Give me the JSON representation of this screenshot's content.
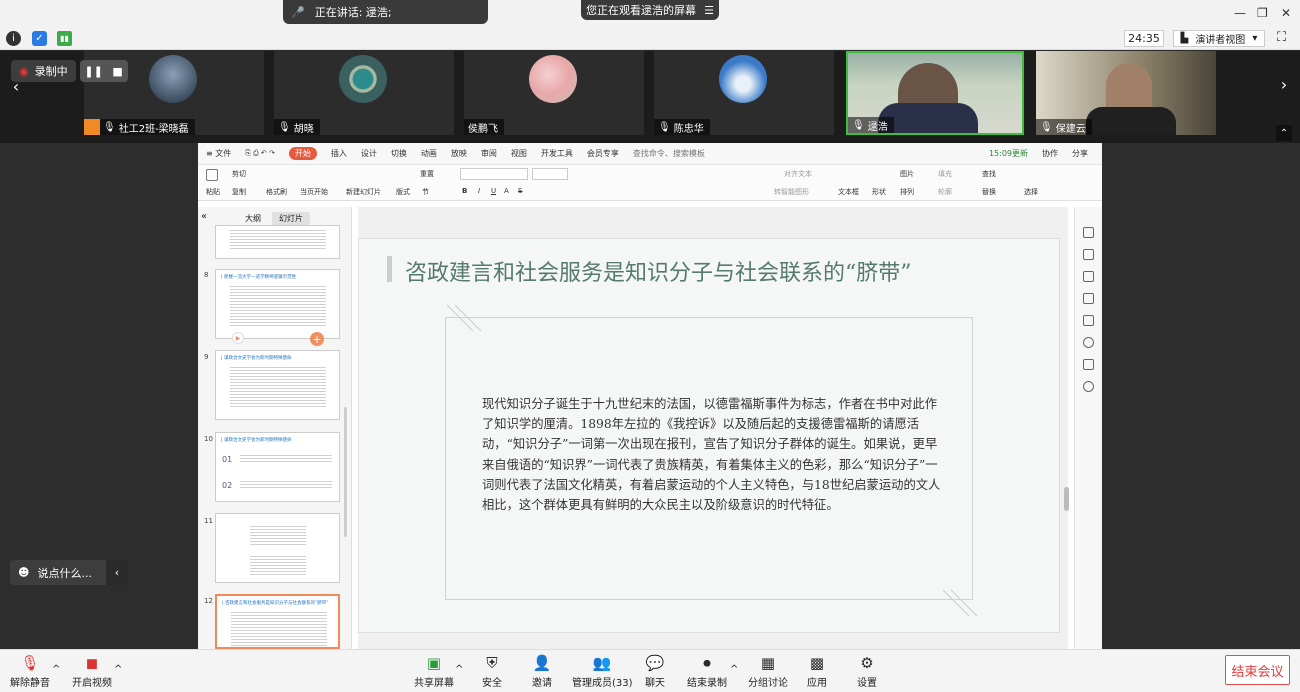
{
  "topbar": {
    "speaking_label": "正在讲话: 逯浩;",
    "viewing_label": "您正在观看逯浩的屏幕",
    "menu_glyph": "☰",
    "minimize": "—",
    "restore": "❐",
    "close": "✕"
  },
  "subbar": {
    "time": "24:35",
    "view_mode": "演讲者视图",
    "dropdown": "▾",
    "fullscreen": "⛶",
    "icons": [
      "info-icon",
      "shield-icon",
      "signal-icon"
    ]
  },
  "recording": {
    "label": "录制中",
    "pause": "❚❚",
    "stop": "■"
  },
  "participants": [
    {
      "name": "社工2班-梁晓磊",
      "mic": "off",
      "avatar_color": "#30455a"
    },
    {
      "name": "胡晓",
      "mic": "off",
      "avatar_color": "#6a8a8a"
    },
    {
      "name": "侯鹏飞",
      "mic": "none",
      "avatar_color": "#d9b8b8"
    },
    {
      "name": "陈忠华",
      "mic": "off",
      "avatar_color": "#4a86c8"
    },
    {
      "name": "逯浩",
      "mic": "on",
      "avatar_color": "#7c6a5a"
    },
    {
      "name": "保建云",
      "mic": "on",
      "avatar_color": "#5c5a52"
    }
  ],
  "wps": {
    "tabs": [
      "≡ 文件",
      "开始",
      "插入",
      "设计",
      "切换",
      "动画",
      "放映",
      "审阅",
      "视图",
      "开发工具",
      "会员专享",
      "查找命令、搜索模板"
    ],
    "active_tab": "开始",
    "right_items": [
      "15:09更新",
      "协作",
      "分享"
    ],
    "ribbon": [
      "粘贴",
      "剪切",
      "复制",
      "格式刷",
      "当页开始",
      "新建幻灯片",
      "版式",
      "节",
      "重置",
      "B",
      "I",
      "U",
      "A",
      "S",
      "对齐文本",
      "转智能图形",
      "文本框",
      "形状",
      "排列",
      "图片",
      "填充",
      "轮廓",
      "查找",
      "替换",
      "选择"
    ],
    "panel_tabs": [
      "大纲",
      "幻灯片"
    ],
    "thumbnails": [
      {
        "num": "",
        "title": ""
      },
      {
        "num": "8",
        "title": "| 爬楼一流大学—适学精神逻辑示范性"
      },
      {
        "num": "9",
        "title": "| 谋政治文史学会为新时期特殊使命"
      },
      {
        "num": "10",
        "title": "| 谋政治文史学会为新时期特殊使命"
      },
      {
        "num": "11",
        "title": ""
      },
      {
        "num": "12",
        "title": "| 咨政建言和社会服务是知识分子与社会联系的“脐带”"
      }
    ],
    "thumb10_nums": [
      "01",
      "02"
    ],
    "slide": {
      "title": "咨政建言和社会服务是知识分子与社会联系的“脐带”",
      "body": "现代知识分子诞生于十九世纪末的法国，以德雷福斯事件为标志，作者在书中对此作了知识学的厘清。1898年左拉的《我控诉》以及随后起的支援德雷福斯的请愿活动，“知识分子”一词第一次出现在报刊，宣告了知识分子群体的诞生。如果说，更早来自俄语的“知识界”一词代表了贵族精英，有着集体主义的色彩，那么“知识分子”一词则代表了法国文化精英，有着启蒙运动的个人主义特色，与18世纪启蒙运动的文人相比，这个群体更具有鲜明的大众民主以及阶级意识的时代特征。"
    }
  },
  "chat": {
    "placeholder": "说点什么...",
    "collapse": "‹"
  },
  "bottombar": {
    "unmute": "解除静音",
    "start_video": "开启视频",
    "share_screen": "共享屏幕",
    "security": "安全",
    "invite": "邀请",
    "manage_members": "管理成员(33)",
    "chat": "聊天",
    "end_recording": "结束录制",
    "breakout": "分组讨论",
    "apps": "应用",
    "settings": "设置",
    "end_meeting": "结束会议"
  }
}
